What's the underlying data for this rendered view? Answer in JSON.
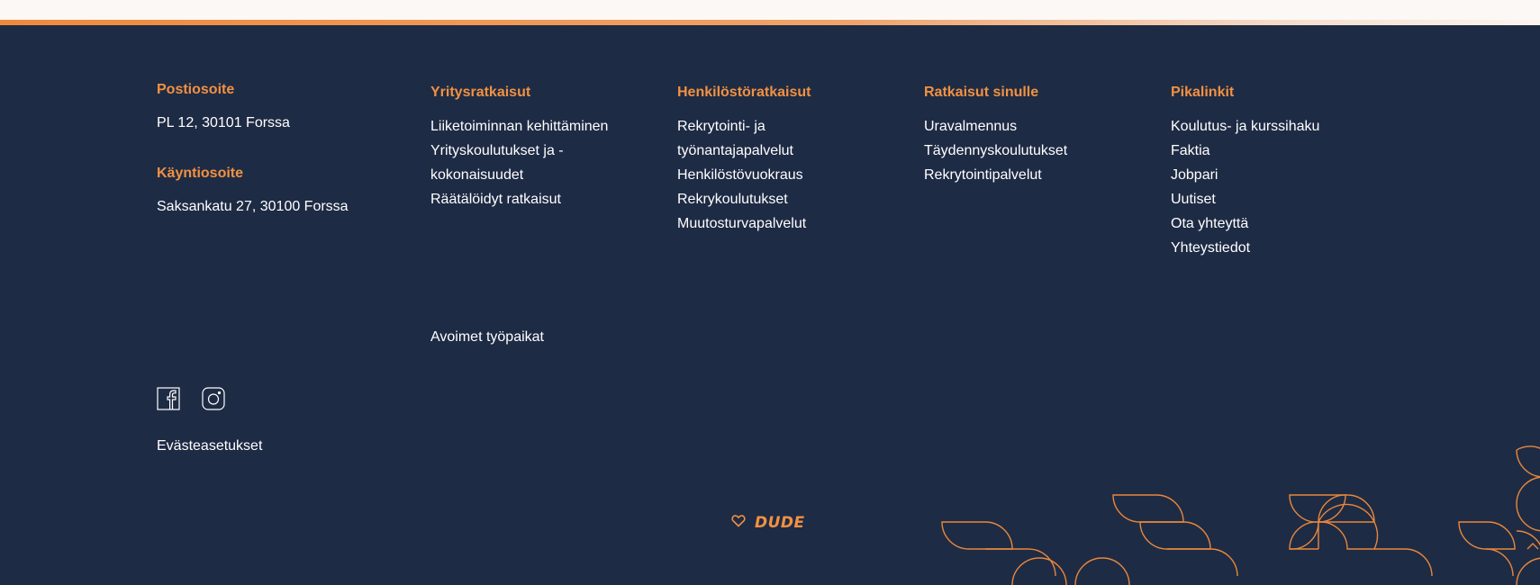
{
  "address": {
    "postal_heading": "Postiosoite",
    "postal_value": "PL 12, 30101 Forssa",
    "visit_heading": "Käyntiosoite",
    "visit_value": "Saksankatu 27, 30100 Forssa"
  },
  "columns": {
    "business": {
      "heading": "Yritysratkaisut",
      "items": [
        {
          "label": "Liiketoiminnan kehittäminen"
        },
        {
          "label": "Yrityskoulutukset ja -kokonaisuudet"
        },
        {
          "label": "Räätälöidyt ratkaisut"
        }
      ]
    },
    "hr": {
      "heading": "Henkilöstöratkaisut",
      "items": [
        {
          "label": "Rekrytointi- ja työnantajapalvelut"
        },
        {
          "label": "Henkilöstövuokraus"
        },
        {
          "label": "Rekrykoulutukset"
        },
        {
          "label": "Muutosturvapalvelut"
        }
      ]
    },
    "you": {
      "heading": "Ratkaisut sinulle",
      "items": [
        {
          "label": "Uravalmennus"
        },
        {
          "label": "Täydennyskoulutukset"
        },
        {
          "label": "Rekrytointipalvelut"
        }
      ]
    },
    "quick": {
      "heading": "Pikalinkit",
      "items": [
        {
          "label": "Koulutus- ja kurssihaku"
        },
        {
          "label": "Faktia"
        },
        {
          "label": "Jobpari"
        },
        {
          "label": "Uutiset"
        },
        {
          "label": "Ota yhteyttä"
        },
        {
          "label": "Yhteystiedot"
        }
      ]
    }
  },
  "extra_link": "Avoimet työpaikat",
  "social": [
    {
      "icon": "facebook-icon"
    },
    {
      "icon": "instagram-icon"
    }
  ],
  "cookies_label": "Evästeasetukset",
  "credit": {
    "icon": "heart-icon",
    "label": "DUDE"
  },
  "colors": {
    "background": "#1e2b44",
    "accent": "#f29142",
    "text": "#ffffff",
    "topbar": "#fcf8f5"
  }
}
